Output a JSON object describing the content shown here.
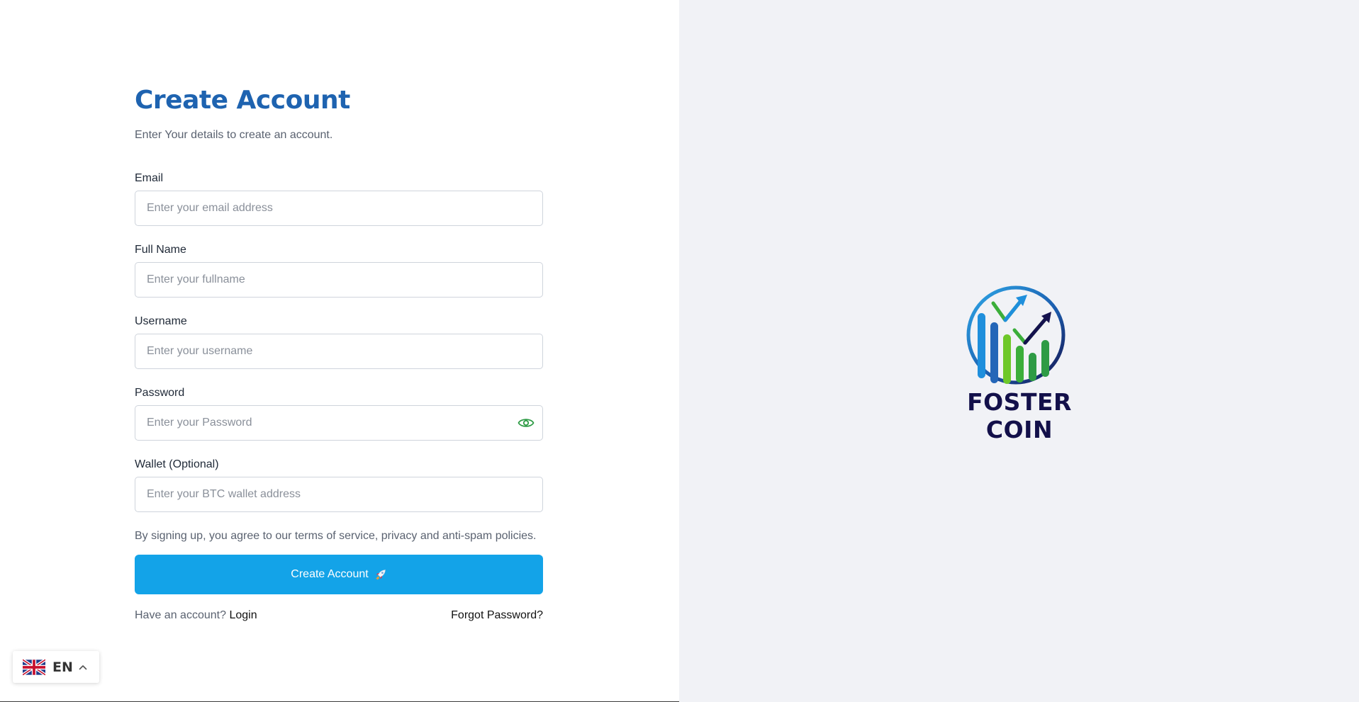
{
  "form": {
    "title": "Create Account",
    "subtitle": "Enter Your details to create an account.",
    "email": {
      "label": "Email",
      "placeholder": "Enter your email address",
      "value": ""
    },
    "full_name": {
      "label": "Full Name",
      "placeholder": "Enter your fullname",
      "value": ""
    },
    "username": {
      "label": "Username",
      "placeholder": "Enter your username",
      "value": ""
    },
    "password": {
      "label": "Password",
      "placeholder": "Enter your Password",
      "value": "",
      "toggle_icon": "eye-icon"
    },
    "wallet": {
      "label": "Wallet (Optional)",
      "placeholder": "Enter your BTC wallet address",
      "value": ""
    },
    "terms": "By signing up, you agree to our terms of service, privacy and anti-spam policies.",
    "submit_label": "Create Account",
    "submit_icon": "rocket-icon",
    "have_account": "Have an account?",
    "login_label": "Login",
    "forgot_label": "Forgot Password?"
  },
  "brand": {
    "name": "FOSTER COIN",
    "logo_icon": "chart-growth-logo"
  },
  "language": {
    "code": "EN",
    "flag_icon": "uk-flag-icon",
    "chevron_icon": "chevron-up-icon"
  },
  "colors": {
    "title": "#1e63b0",
    "primary_button": "#13a3e8",
    "eye_icon": "#2e9b45",
    "brand_text": "#13104a",
    "right_pane_bg": "#f1f2f6"
  }
}
